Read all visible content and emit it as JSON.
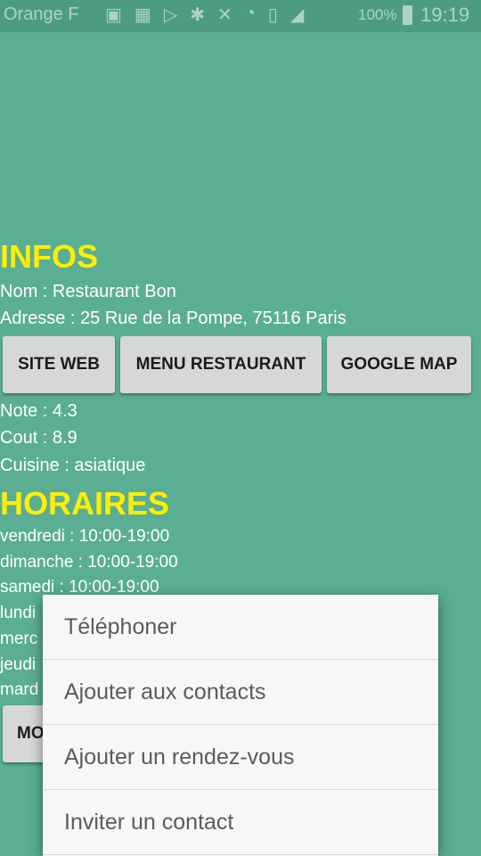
{
  "status_bar": {
    "carrier": "Orange F",
    "battery_percent": "100%",
    "clock": "19:19",
    "icons": [
      "image-icon",
      "calendar-icon",
      "play-icon",
      "bluetooth-icon",
      "mute-icon",
      "alarm-icon",
      "vibrate-icon",
      "signal-icon"
    ]
  },
  "infos": {
    "title": "INFOS",
    "nom": "Nom : Restaurant Bon",
    "adresse": "Adresse : 25 Rue de la Pompe, 75116 Paris",
    "buttons": {
      "site_web": "SITE WEB",
      "menu_restaurant": "MENU RESTAURANT",
      "google_map": "GOOGLE MAP"
    },
    "note": "Note : 4.3",
    "cout": "Cout : 8.9",
    "cuisine": "Cuisine : asiatique"
  },
  "horaires": {
    "title": "HORAIRES",
    "days": [
      "vendredi : 10:00-19:00",
      "dimanche : 10:00-19:00",
      "samedi : 10:00-19:00",
      "lundi",
      "merc",
      "jeudi",
      "mard"
    ],
    "more_button": "MO"
  },
  "context_menu": {
    "items": [
      "Téléphoner",
      "Ajouter aux contacts",
      "Ajouter un rendez-vous",
      "Inviter un contact"
    ]
  },
  "colors": {
    "background": "#5aae94",
    "heading": "#ffef00",
    "button": "#d6d7d7",
    "menu": "#f7f7f7"
  }
}
